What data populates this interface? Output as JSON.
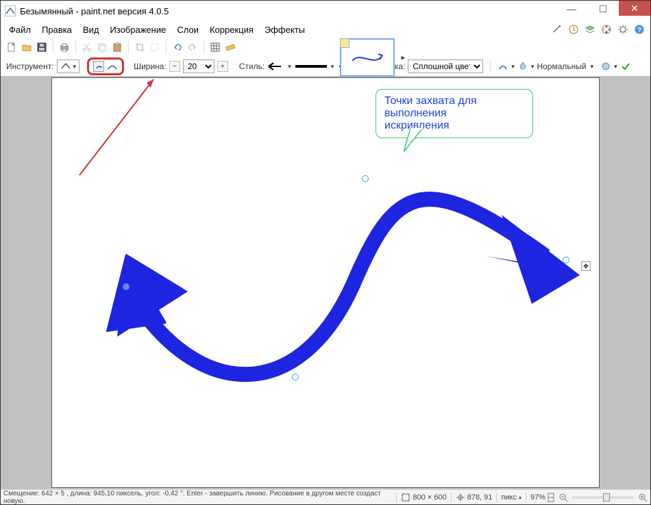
{
  "title": "Безымянный - paint.net версия 4.0.5",
  "menu": {
    "file": "Файл",
    "edit": "Правка",
    "view": "Вид",
    "image": "Изображение",
    "layers": "Слои",
    "adjust": "Коррекция",
    "effects": "Эффекты"
  },
  "optbar": {
    "tool_label": "Инструмент:",
    "width_label": "Ширина:",
    "width_value": "20",
    "style_label": "Стиль:",
    "fill_label": "Заливка:",
    "fill_value": "Сплошной цвет",
    "blend_label": "Нормальный"
  },
  "callout": {
    "line1": "Точки захвата для",
    "line2": "выполнения",
    "line3": "искривления"
  },
  "status": {
    "left": "Смещение: 642 × 5 , длина: 945,10 пиксель, угол: -0,42 °. Enter - завершить линию. Рисование в другом месте создаст новую.",
    "canvas_size": "800 × 600",
    "cursor_pos": "878, 91",
    "units": "пикс",
    "zoom": "97%"
  },
  "colors": {
    "curve": "#1e25e0",
    "callout_border": "#3bc97a",
    "annotation_arrow": "#d13438"
  }
}
